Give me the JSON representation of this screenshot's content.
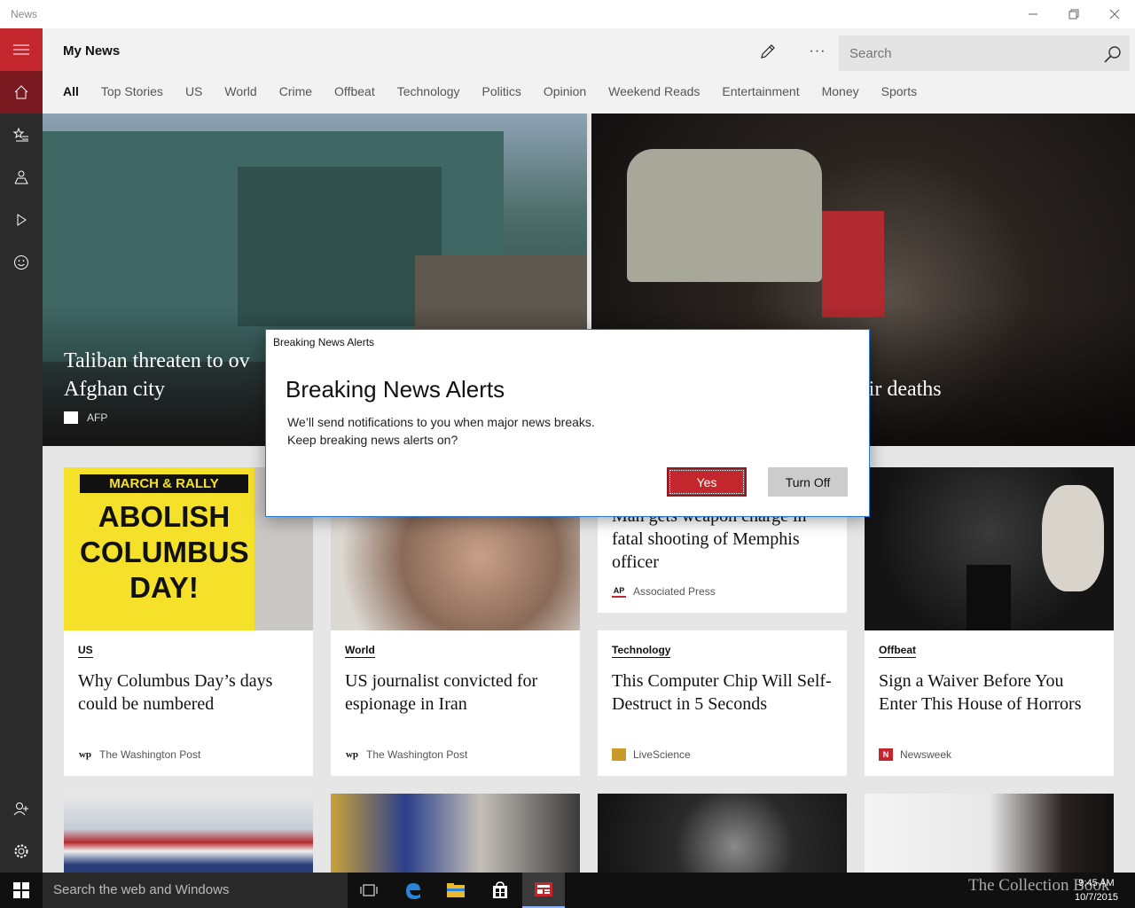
{
  "window": {
    "title": "News"
  },
  "header": {
    "title": "My News",
    "search_placeholder": "Search",
    "more_label": "···"
  },
  "tabs": [
    "All",
    "Top Stories",
    "US",
    "World",
    "Crime",
    "Offbeat",
    "Technology",
    "Politics",
    "Opinion",
    "Weekend Reads",
    "Entertainment",
    "Money",
    "Sports"
  ],
  "heroes": [
    {
      "title": "Taliban threaten to ov\nAfghan city",
      "title_line1": "Taliban threaten to ov",
      "title_line2": "Afghan city",
      "source": "AFP"
    },
    {
      "title_fragment": "heir deaths"
    }
  ],
  "cards": [
    {
      "category": "US",
      "title": "Why Columbus Day’s days could be numbered",
      "source": "The Washington Post",
      "sign_top": "MARCH & RALLY",
      "sign_body": "ABOLISH COLUMBUS DAY!"
    },
    {
      "category": "World",
      "title": "US journalist convicted for espionage in Iran",
      "source": "The Washington Post"
    },
    {
      "title": "Man gets weapon charge in fatal shooting of Memphis officer",
      "source": "Associated Press"
    },
    {
      "category": "Technology",
      "title": "This Computer Chip Will Self-Destruct in 5 Seconds",
      "source": "LiveScience"
    },
    {
      "category": "Offbeat",
      "title": "Sign a Waiver Before You Enter This House of Horrors",
      "source": "Newsweek"
    }
  ],
  "dialog": {
    "window_title": "Breaking News Alerts",
    "heading": "Breaking News Alerts",
    "message_line1": "We’ll send notifications to you when major news breaks.",
    "message_line2": "Keep breaking news alerts on?",
    "yes_label": "Yes",
    "off_label": "Turn Off"
  },
  "taskbar": {
    "search_placeholder": "Search the web and Windows",
    "time": "9:45 AM",
    "date": "10/7/2015",
    "watermark": "The Collection Book"
  },
  "colors": {
    "accent": "#c4262e",
    "rail": "#2b2b2b",
    "rail_active": "#7a1a20"
  }
}
